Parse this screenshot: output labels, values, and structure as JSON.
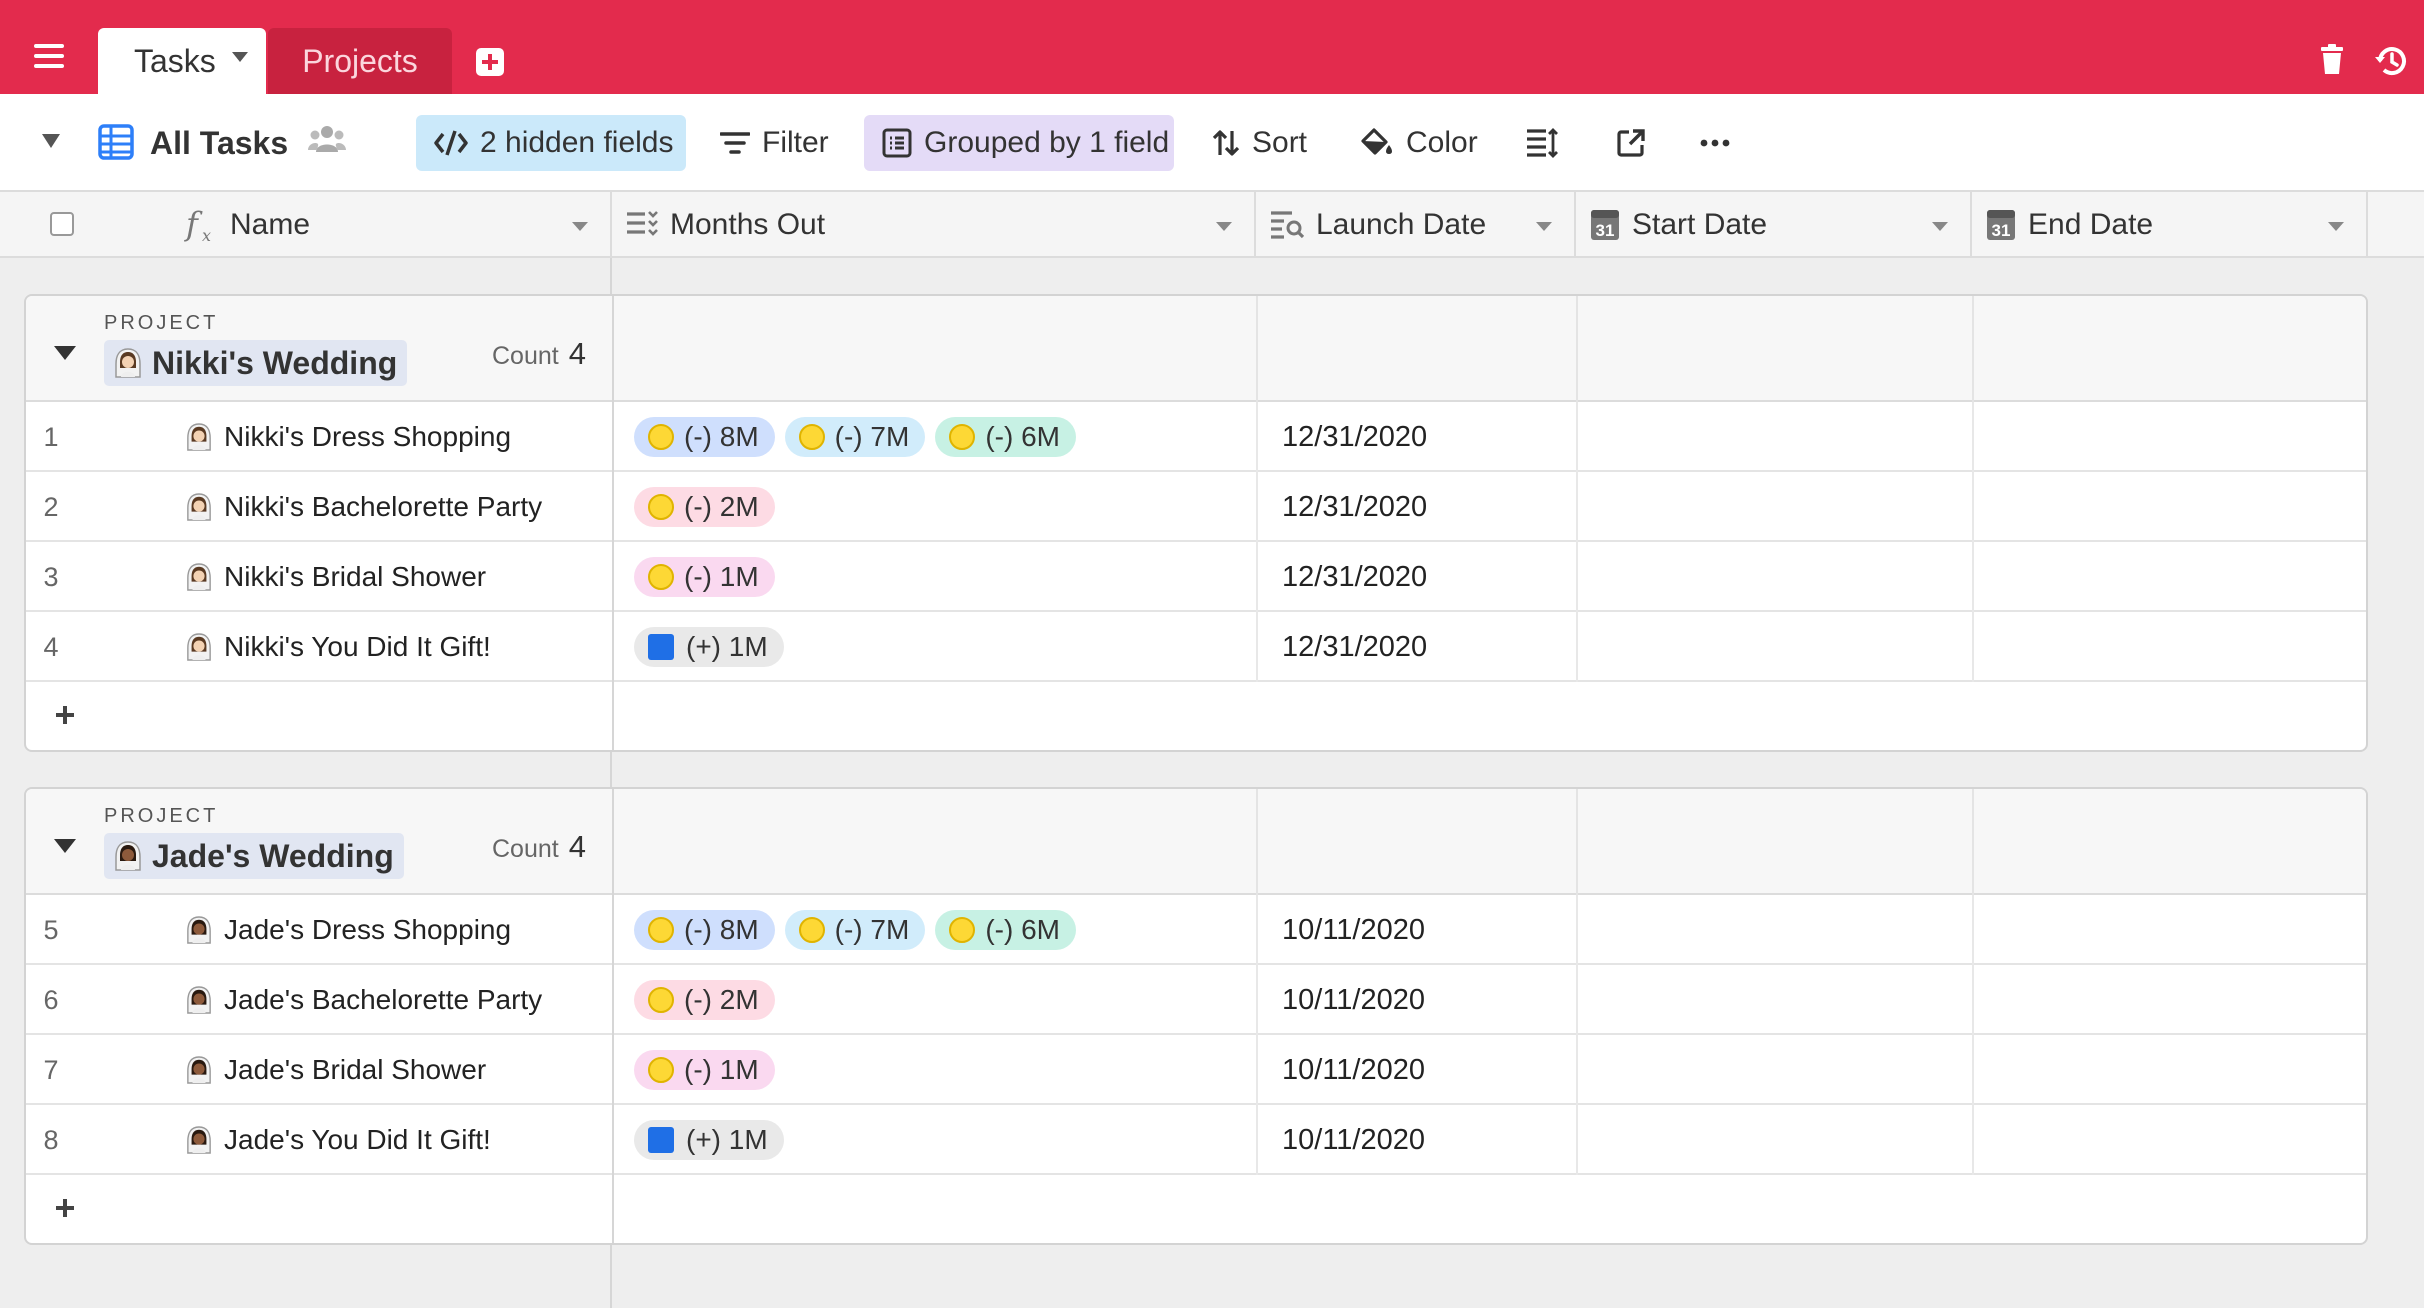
{
  "topbar": {
    "tabs": [
      {
        "label": "Tasks",
        "active": true
      },
      {
        "label": "Projects",
        "active": false
      }
    ],
    "icons": [
      "hamburger-menu-icon",
      "add-table-icon",
      "trash-icon",
      "history-icon"
    ],
    "colors": {
      "accent": "#e32b4d"
    }
  },
  "viewbar": {
    "view_name": "All Tasks",
    "hidden_fields": "2 hidden fields",
    "filter": "Filter",
    "grouped": "Grouped by 1 field",
    "sort": "Sort",
    "color": "Color"
  },
  "columns": [
    {
      "label": "Name",
      "icon": "formula-icon"
    },
    {
      "label": "Months Out",
      "icon": "multi-select-icon"
    },
    {
      "label": "Launch Date",
      "icon": "lookup-icon"
    },
    {
      "label": "Start Date",
      "icon": "calendar-icon"
    },
    {
      "label": "End Date",
      "icon": "calendar-icon"
    }
  ],
  "calendar_icon_text": "31",
  "groups": [
    {
      "label": "PROJECT",
      "name": "Nikki's Wedding",
      "count_label": "Count",
      "count": "4",
      "rows": [
        {
          "num": "1",
          "name": "Nikki's Dress Shopping",
          "launch": "12/31/2020",
          "chips": [
            {
              "text": "(-) 8M",
              "color": "blue",
              "mark": "dot"
            },
            {
              "text": "(-) 7M",
              "color": "lightblue",
              "mark": "dot"
            },
            {
              "text": "(-) 6M",
              "color": "teal",
              "mark": "dot"
            }
          ]
        },
        {
          "num": "2",
          "name": "Nikki's Bachelorette Party",
          "launch": "12/31/2020",
          "chips": [
            {
              "text": "(-) 2M",
              "color": "pink",
              "mark": "dot"
            }
          ]
        },
        {
          "num": "3",
          "name": "Nikki's Bridal Shower",
          "launch": "12/31/2020",
          "chips": [
            {
              "text": "(-) 1M",
              "color": "magenta",
              "mark": "dot"
            }
          ]
        },
        {
          "num": "4",
          "name": "Nikki's You Did It Gift!",
          "launch": "12/31/2020",
          "chips": [
            {
              "text": "(+) 1M",
              "color": "gray",
              "mark": "square"
            }
          ]
        }
      ]
    },
    {
      "label": "PROJECT",
      "name": "Jade's Wedding",
      "count_label": "Count",
      "count": "4",
      "rows": [
        {
          "num": "5",
          "name": "Jade's Dress Shopping",
          "launch": "10/11/2020",
          "chips": [
            {
              "text": "(-) 8M",
              "color": "blue",
              "mark": "dot"
            },
            {
              "text": "(-) 7M",
              "color": "lightblue",
              "mark": "dot"
            },
            {
              "text": "(-) 6M",
              "color": "teal",
              "mark": "dot"
            }
          ]
        },
        {
          "num": "6",
          "name": "Jade's Bachelorette Party",
          "launch": "10/11/2020",
          "chips": [
            {
              "text": "(-) 2M",
              "color": "pink",
              "mark": "dot"
            }
          ]
        },
        {
          "num": "7",
          "name": "Jade's Bridal Shower",
          "launch": "10/11/2020",
          "chips": [
            {
              "text": "(-) 1M",
              "color": "magenta",
              "mark": "dot"
            }
          ]
        },
        {
          "num": "8",
          "name": "Jade's You Did It Gift!",
          "launch": "10/11/2020",
          "chips": [
            {
              "text": "(+) 1M",
              "color": "gray",
              "mark": "square"
            }
          ]
        }
      ]
    }
  ]
}
